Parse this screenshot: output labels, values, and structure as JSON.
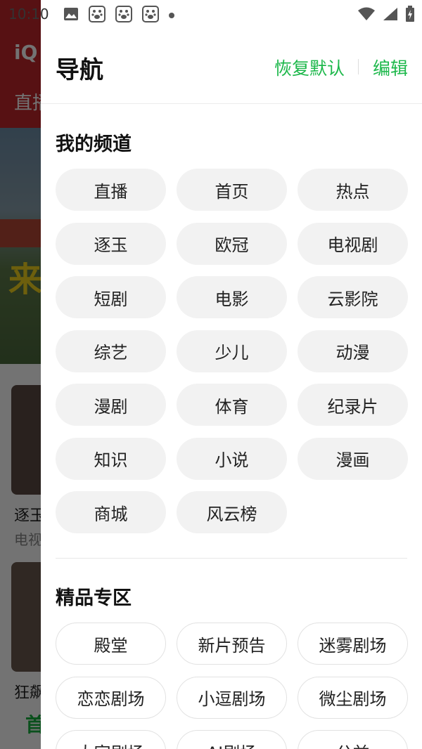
{
  "status_bar": {
    "time": "10:10",
    "left_icons": [
      "gallery-icon",
      "baidu-icon",
      "baidu-icon",
      "baidu-icon",
      "notification-dot-icon"
    ],
    "right_icons": [
      "wifi-icon",
      "signal-icon",
      "battery-charging-icon"
    ]
  },
  "background": {
    "logo": "iQ",
    "tab": "直播",
    "banner_text": "来",
    "items": [
      {
        "title": "逐玉",
        "subtitle": "电视"
      },
      {
        "title": "狂飙"
      }
    ],
    "bottom_nav": "首"
  },
  "drawer": {
    "title": "导航",
    "reset_label": "恢复默认",
    "edit_label": "编辑",
    "my_channels": {
      "title": "我的频道",
      "items": [
        "直播",
        "首页",
        "热点",
        "逐玉",
        "欧冠",
        "电视剧",
        "短剧",
        "电影",
        "云影院",
        "综艺",
        "少儿",
        "动漫",
        "漫剧",
        "体育",
        "纪录片",
        "知识",
        "小说",
        "漫画",
        "商城",
        "风云榜"
      ]
    },
    "premium": {
      "title": "精品专区",
      "items": [
        "殿堂",
        "新片预告",
        "迷雾剧场",
        "恋恋剧场",
        "小逗剧场",
        "微尘剧场",
        "大家剧场",
        "AI剧场",
        "公益"
      ]
    }
  },
  "colors": {
    "accent": "#1db84b",
    "chip_bg": "#f2f2f2",
    "header_red": "#c0272c"
  }
}
